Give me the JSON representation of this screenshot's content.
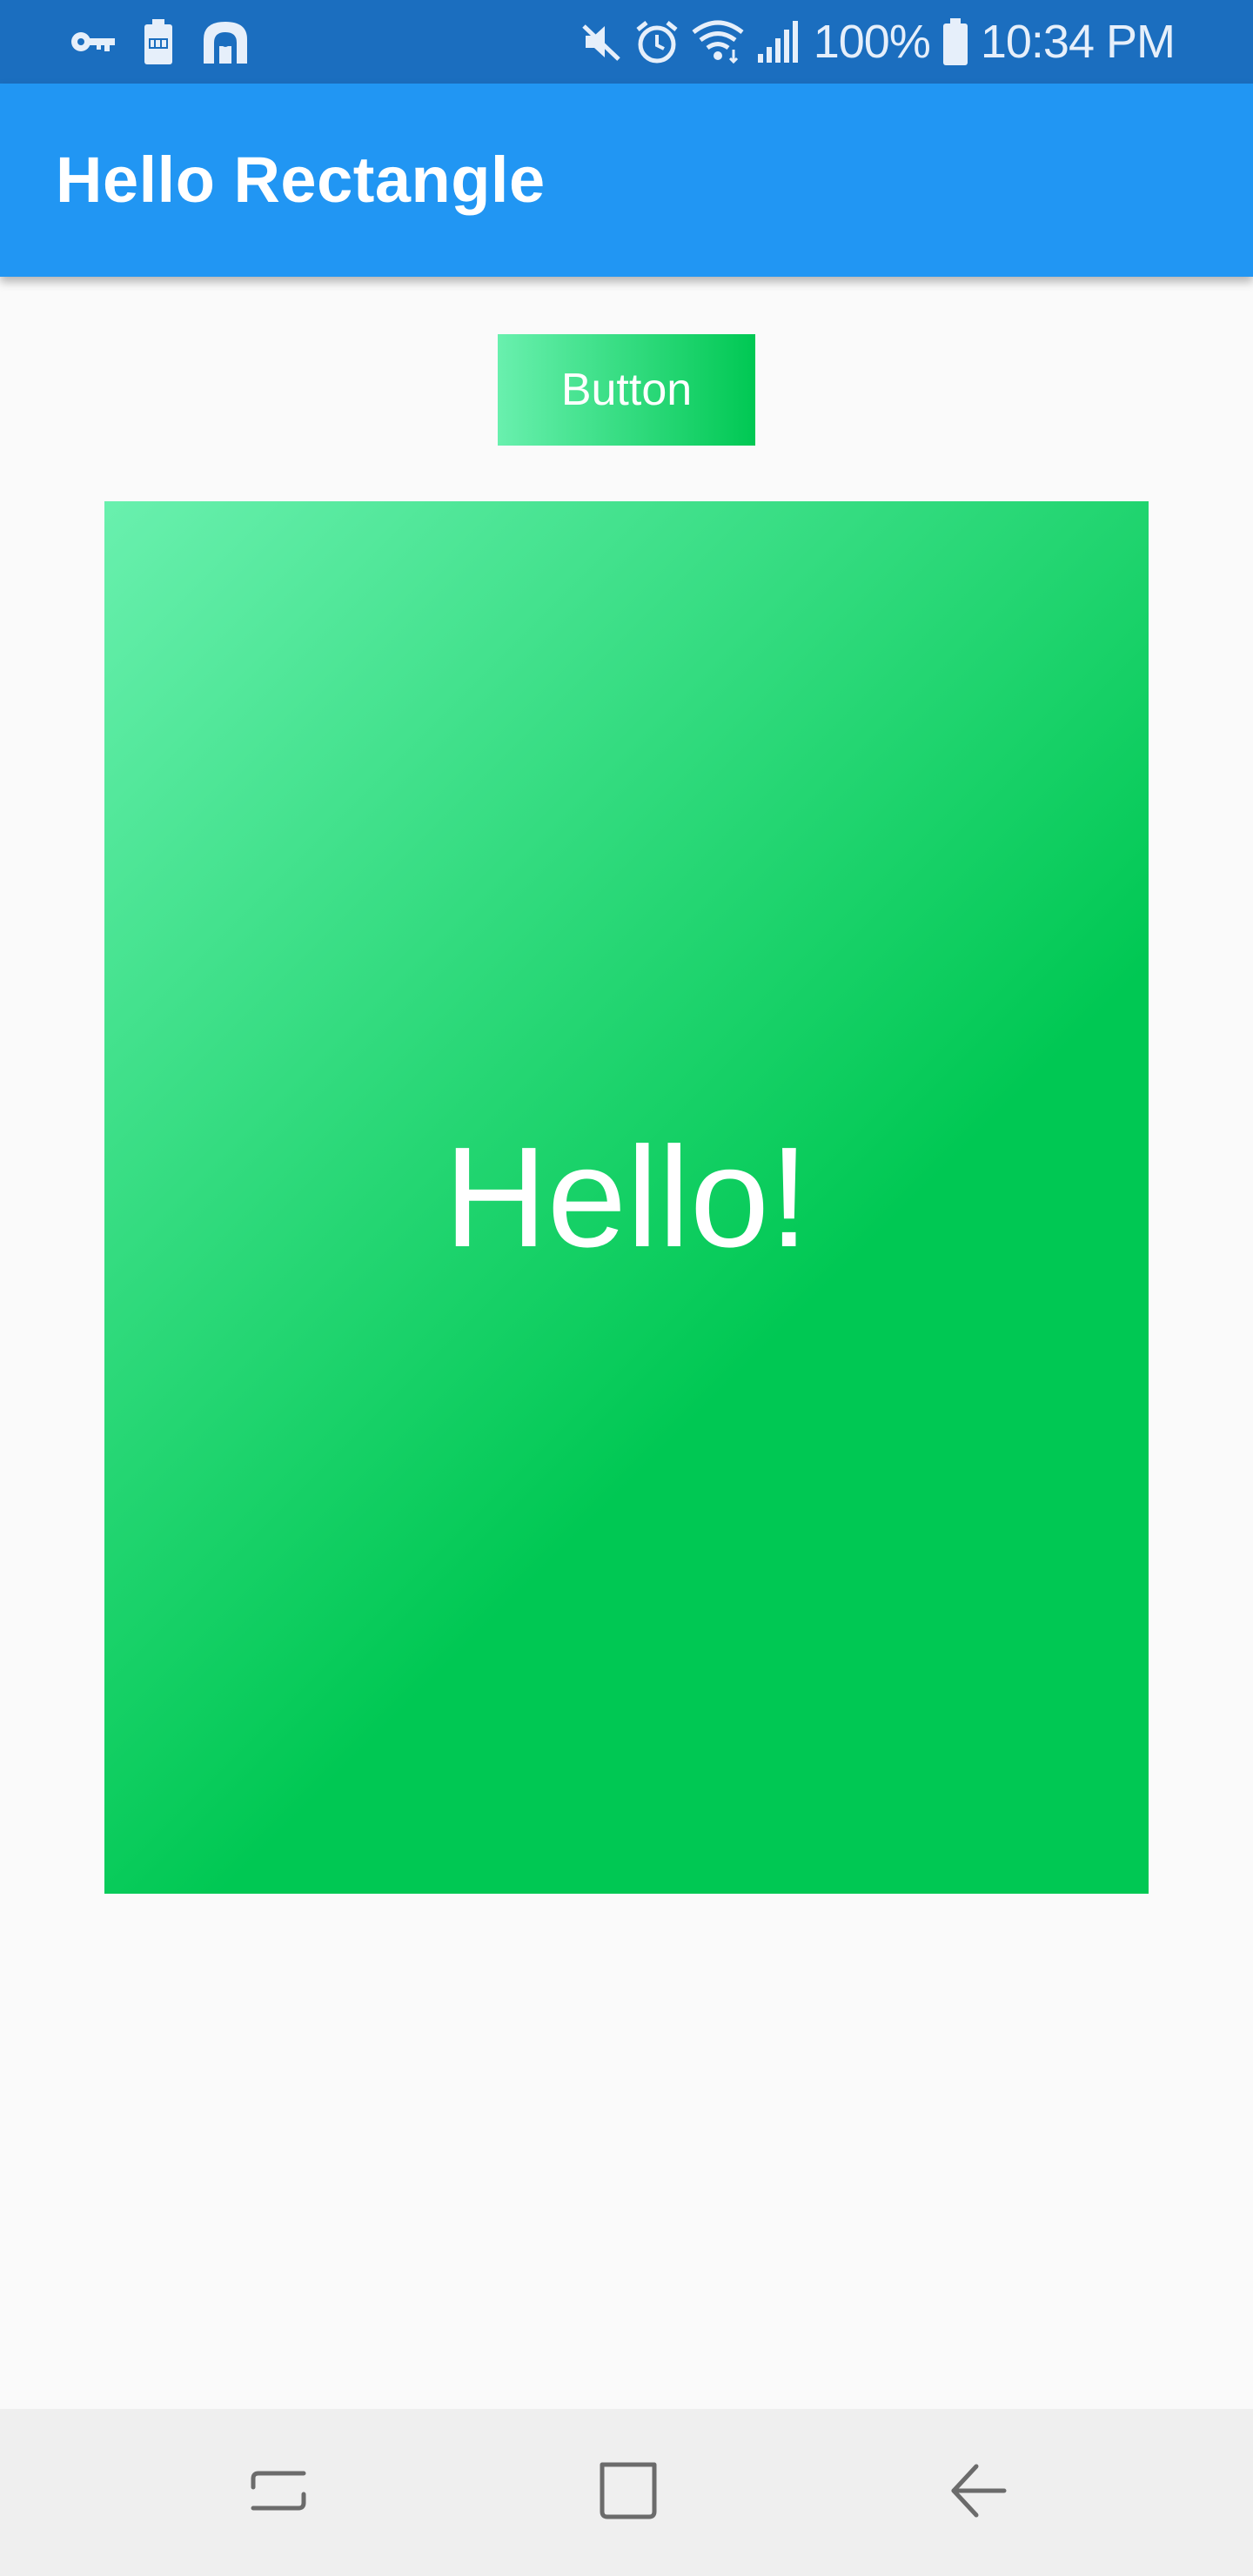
{
  "status_bar": {
    "battery_percent": "100%",
    "time": "10:34 PM",
    "left_icons": [
      "key-icon",
      "battery-saver-icon",
      "arch-app-icon"
    ],
    "right_icons": [
      "mute-icon",
      "alarm-icon",
      "wifi-icon",
      "signal-icon",
      "battery-icon"
    ],
    "background_color": "#1b6ebf"
  },
  "app_bar": {
    "title": "Hello Rectangle",
    "background_color": "#2196f3"
  },
  "main": {
    "button_label": "Button",
    "rectangle_text": "Hello!",
    "gradient_colors": [
      "#69f0ae",
      "#00c853"
    ]
  },
  "nav_bar": {
    "buttons": [
      "recents-icon",
      "home-icon",
      "back-icon"
    ]
  }
}
